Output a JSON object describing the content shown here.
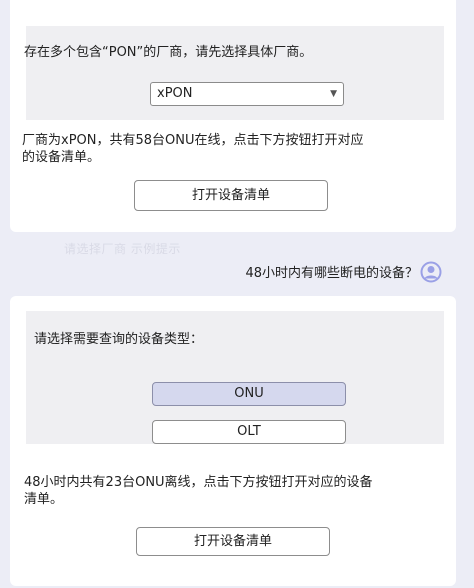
{
  "colors": {
    "accent": "#8a8fe0",
    "selected_option_bg": "#d5d8ee",
    "panel_bg": "#efeff2",
    "page_bg": "#ecedf6"
  },
  "card1": {
    "prompt": "存在多个包含“PON”的厂商，请先选择具体厂商。",
    "vendor_select_value": "xPON",
    "result_line1": "厂商为xPON，共有58台ONU在线，点击下方按钮打开对应",
    "result_line2": "的设备清单。",
    "open_button": "打开设备清单"
  },
  "faded_text": "请选择厂商 示例提示",
  "user_message": {
    "text": "48小时内有哪些断电的设备？",
    "avatar_icon": "user-avatar-icon"
  },
  "card2": {
    "prompt": "请选择需要查询的设备类型：",
    "options": [
      "ONU",
      "OLT"
    ],
    "selected_option": "ONU",
    "result_line1": "48小时内共有23台ONU离线，点击下方按钮打开对应的设备",
    "result_line2": "清单。",
    "open_button": "打开设备清单"
  }
}
